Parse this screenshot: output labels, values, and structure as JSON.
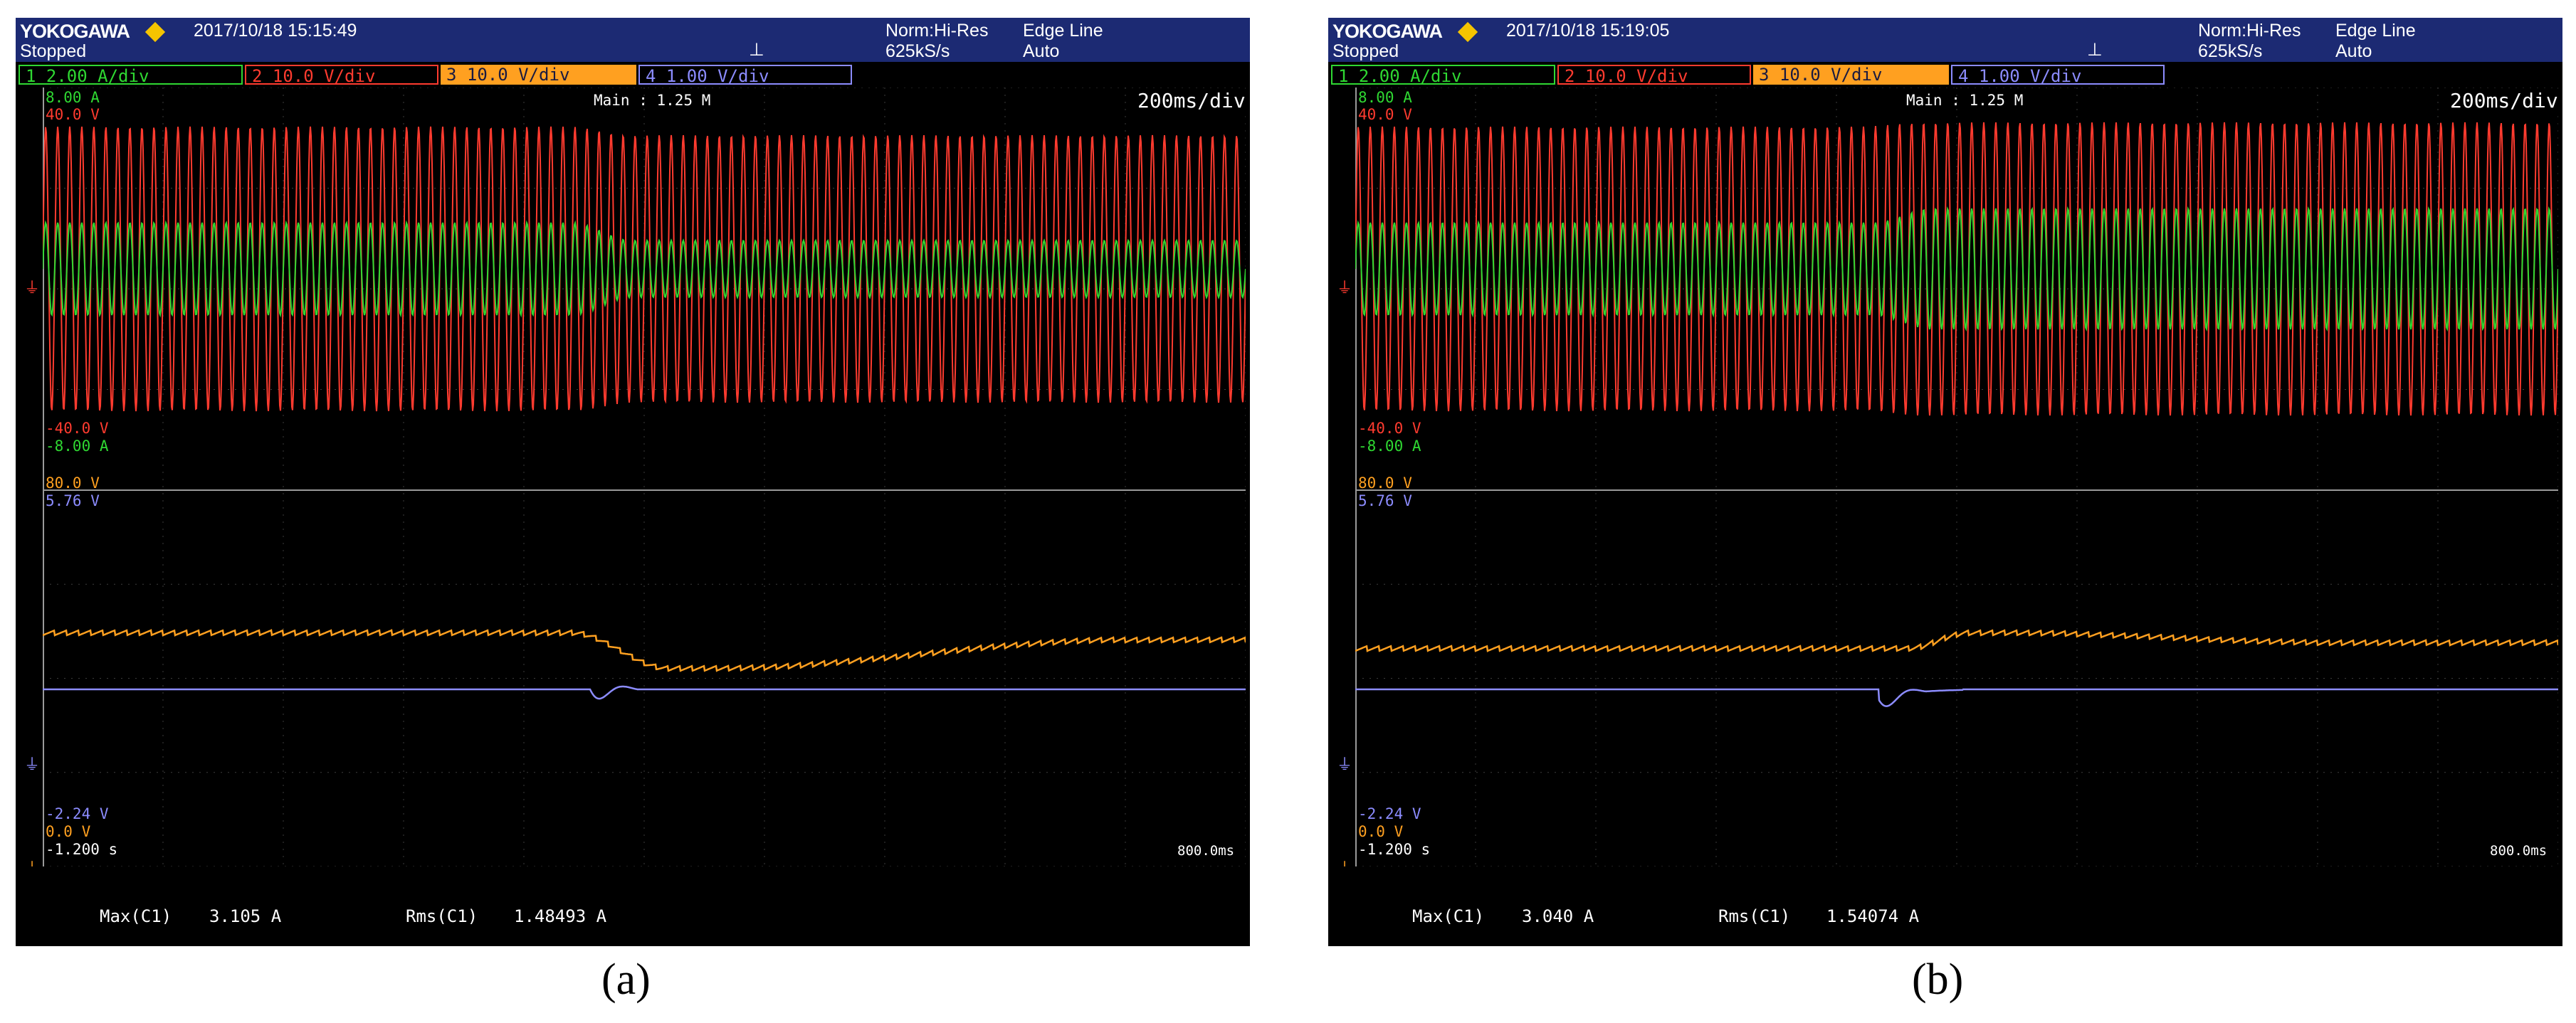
{
  "colors": {
    "ch1": "#2fd832",
    "ch2": "#ff3b2f",
    "ch3": "#ffa020",
    "ch4": "#8c8cff",
    "header": "#1c2a73",
    "brand_diamond": "#f5c400"
  },
  "panels": [
    {
      "brand": "YOKOGAWA",
      "timestamp": "2017/10/18  15:15:49",
      "state": "Stopped",
      "acq_mode": "Norm:Hi-Res",
      "sample_rate": "625kS/s",
      "trigger_type": "Edge Line",
      "trigger_mode": "Auto",
      "channels": [
        {
          "num": "1",
          "scale": "2.00 A/div"
        },
        {
          "num": "2",
          "scale": "10.0 V/div"
        },
        {
          "num": "3",
          "scale": "10.0 V/div"
        },
        {
          "num": "4",
          "scale": "1.00 V/div"
        }
      ],
      "record_length": "Main : 1.25 M",
      "timebase": "200ms/div",
      "upper": {
        "ch1_top": "8.00 A",
        "ch2_top": "40.0 V",
        "ch2_bottom": "-40.0 V",
        "ch1_bottom": "-8.00 A"
      },
      "lower": {
        "ch3_top": "80.0 V",
        "ch4_top": "5.76 V",
        "ch4_bottom": "-2.24 V",
        "ch3_bottom": "0.0 V"
      },
      "time_start": "-1.200 s",
      "time_end": "800.0ms",
      "measurements": [
        {
          "label": "Max(C1)",
          "value": "3.105 A"
        },
        {
          "label": "Rms(C1)",
          "value": "1.48493 A"
        }
      ],
      "caption": "(a)"
    },
    {
      "brand": "YOKOGAWA",
      "timestamp": "2017/10/18  15:19:05",
      "state": "Stopped",
      "acq_mode": "Norm:Hi-Res",
      "sample_rate": "625kS/s",
      "trigger_type": "Edge Line",
      "trigger_mode": "Auto",
      "channels": [
        {
          "num": "1",
          "scale": "2.00 A/div"
        },
        {
          "num": "2",
          "scale": "10.0 V/div"
        },
        {
          "num": "3",
          "scale": "10.0 V/div"
        },
        {
          "num": "4",
          "scale": "1.00 V/div"
        }
      ],
      "record_length": "Main : 1.25 M",
      "timebase": "200ms/div",
      "upper": {
        "ch1_top": "8.00 A",
        "ch2_top": "40.0 V",
        "ch2_bottom": "-40.0 V",
        "ch1_bottom": "-8.00 A"
      },
      "lower": {
        "ch3_top": "80.0 V",
        "ch4_top": "5.76 V",
        "ch4_bottom": "-2.24 V",
        "ch3_bottom": "0.0 V"
      },
      "time_start": "-1.200 s",
      "time_end": "800.0ms",
      "measurements": [
        {
          "label": "Max(C1)",
          "value": "3.040 A"
        },
        {
          "label": "Rms(C1)",
          "value": "1.54074 A"
        }
      ],
      "caption": "(b)"
    }
  ]
}
